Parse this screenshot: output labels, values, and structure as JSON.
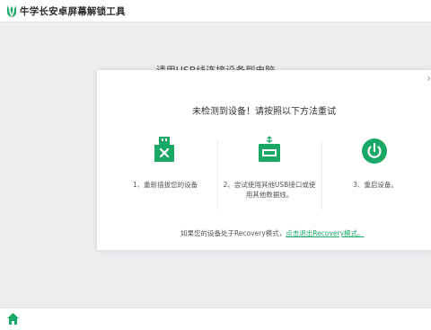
{
  "app": {
    "title": "牛学长安卓屏幕解锁工具"
  },
  "background": {
    "hint": "请用USB线连接设备到电脑"
  },
  "dialog": {
    "title": "未检测到设备！请按照以下方法重试",
    "close_icon": "close-icon",
    "steps": [
      {
        "icon": "usb-unplug-icon",
        "lines": [
          "1、重新插拔您的设备"
        ]
      },
      {
        "icon": "usb-port-icon",
        "lines": [
          "2、尝试使用其他USB接口或使",
          "用其他数据线。"
        ]
      },
      {
        "icon": "power-icon",
        "lines": [
          "3、重启设备。"
        ]
      }
    ],
    "footer": {
      "text": "如果您的设备处于Recovery模式，",
      "link": "点击退出Recovery模式。"
    }
  },
  "bottom": {
    "home_icon": "home-icon"
  },
  "colors": {
    "accent": "#1aa866",
    "background": "#ededf0"
  }
}
